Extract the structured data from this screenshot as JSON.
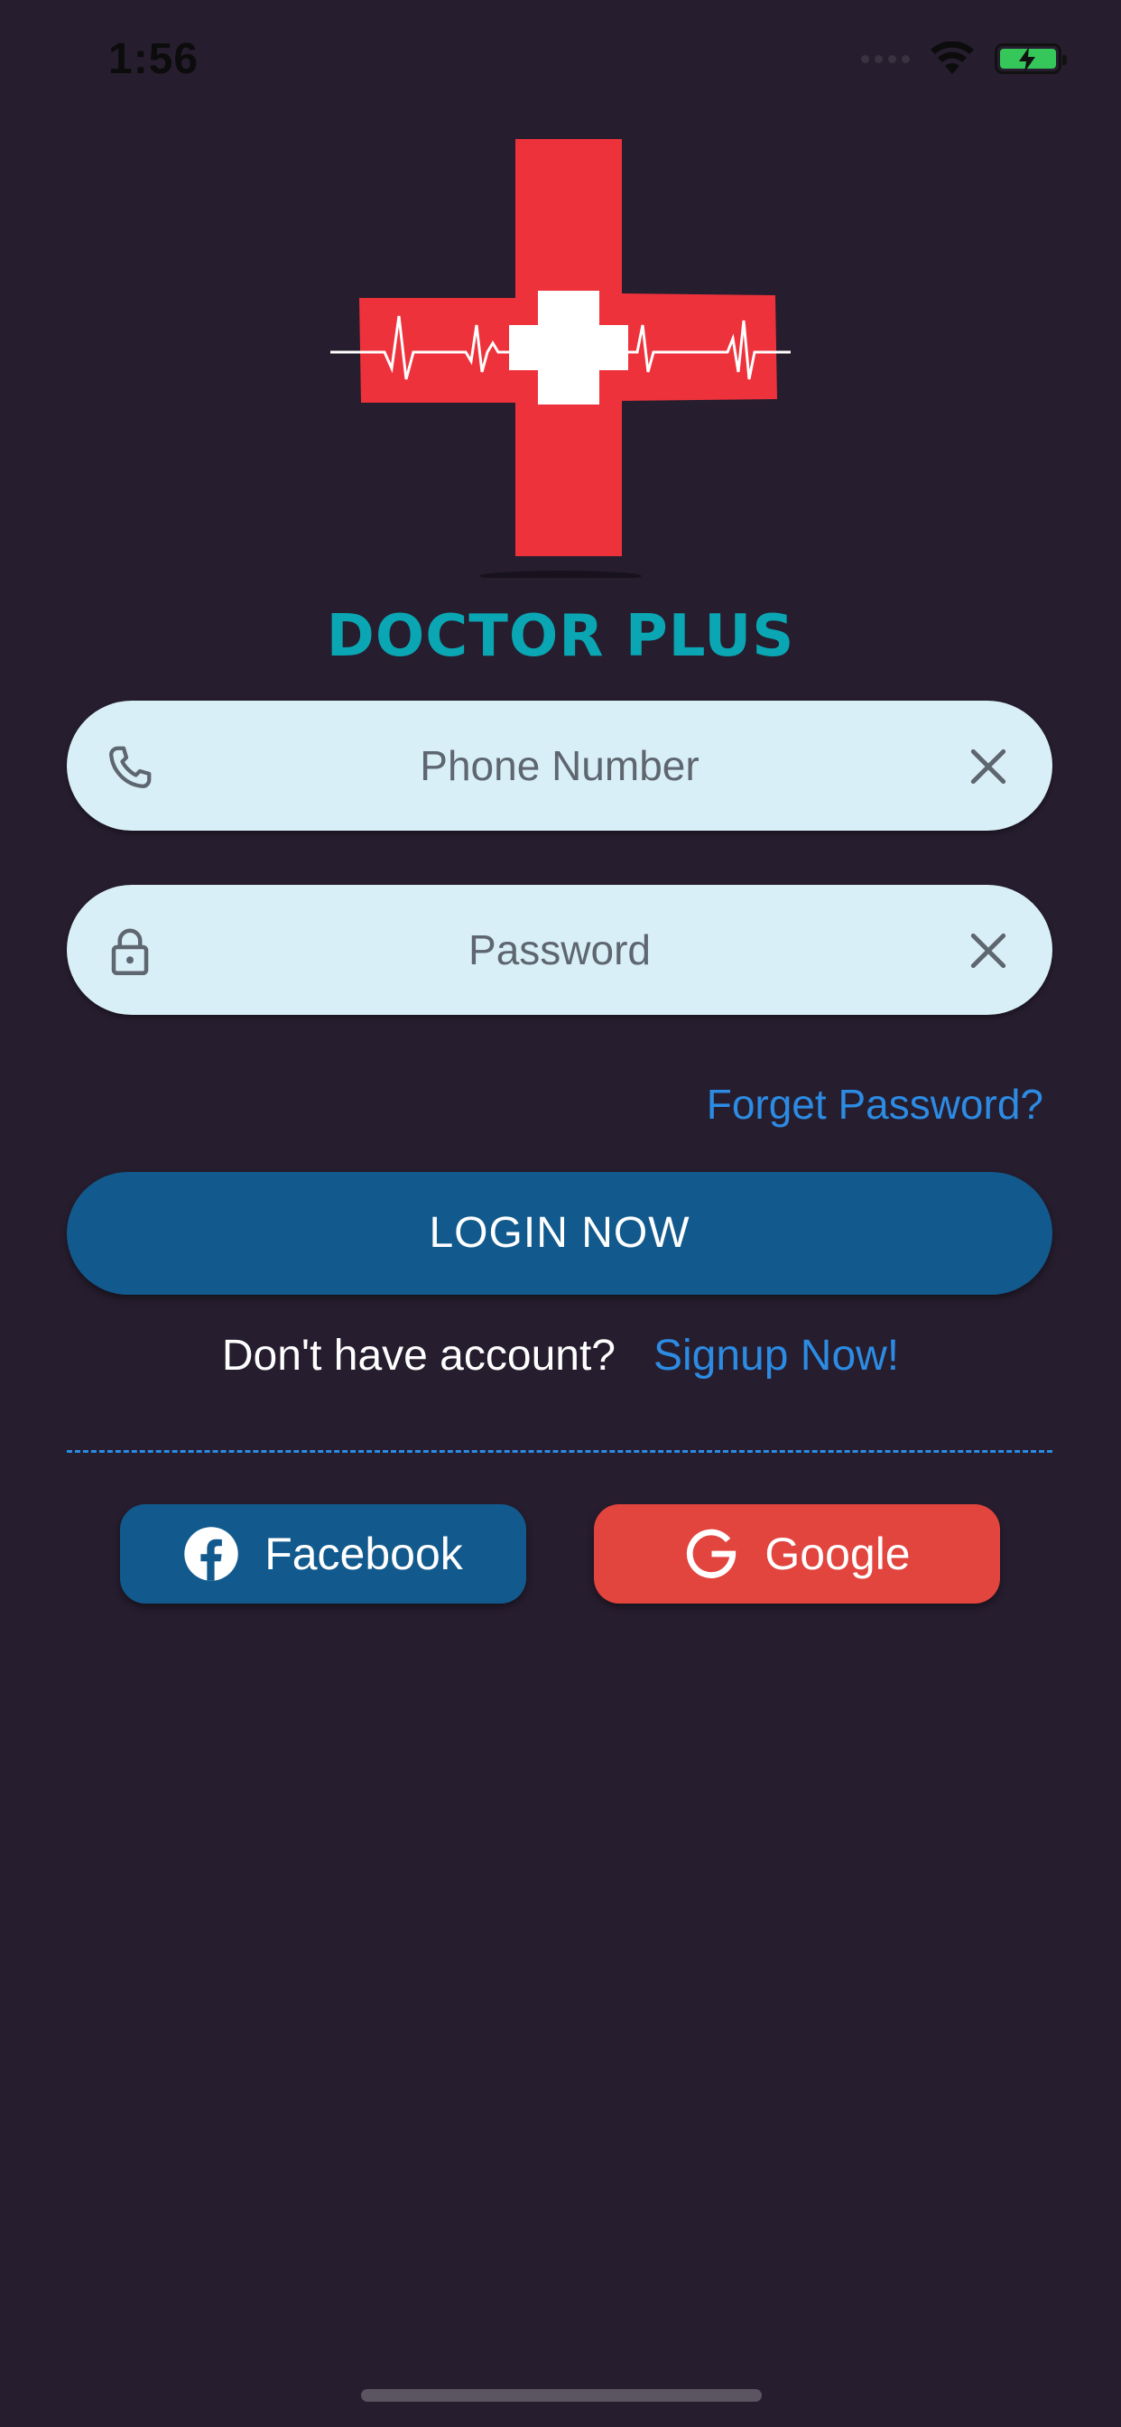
{
  "status_bar": {
    "time": "1:56"
  },
  "app": {
    "title": "DOCTOR PLUS",
    "brand_color": "#0aa6b3"
  },
  "form": {
    "phone": {
      "placeholder": "Phone Number",
      "value": ""
    },
    "password": {
      "placeholder": "Password",
      "value": ""
    },
    "forget_label": "Forget Password?",
    "login_label": "LOGIN NOW",
    "signup_question": "Don't have account?",
    "signup_link": "Signup Now!"
  },
  "social": {
    "facebook_label": "Facebook",
    "google_label": "Google"
  },
  "colors": {
    "background": "#261d2e",
    "field": "#d9eff7",
    "primary": "#125a8d",
    "link": "#2c8be3",
    "google": "#e2443e",
    "logo_red": "#ee323b"
  }
}
